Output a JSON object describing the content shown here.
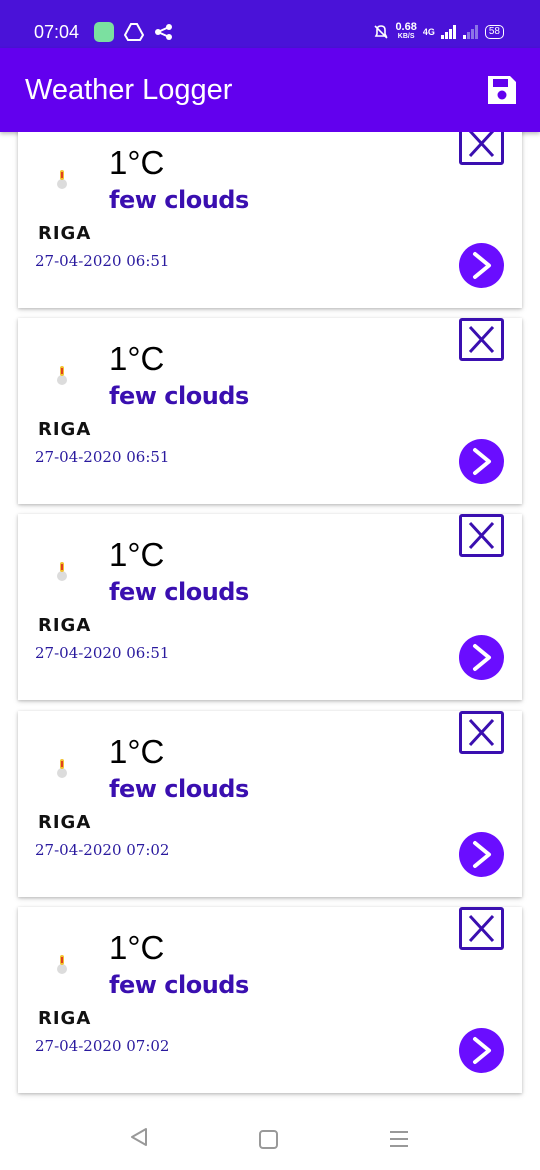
{
  "status_bar": {
    "time": "07:04",
    "net_speed": "0.68",
    "net_unit": "KB/S",
    "network": "4G",
    "battery": "58"
  },
  "app_bar": {
    "title": "Weather Logger",
    "save_icon": "save-icon"
  },
  "colors": {
    "status_bar": "#4a12d8",
    "app_bar": "#6200ee",
    "accent": "#6a0dff",
    "description_text": "#3a0fb0"
  },
  "entries": [
    {
      "temperature": "1°C",
      "description": "few clouds",
      "city": "RIGA",
      "datetime": "27-04-2020  06:51"
    },
    {
      "temperature": "1°C",
      "description": "few clouds",
      "city": "RIGA",
      "datetime": "27-04-2020  06:51"
    },
    {
      "temperature": "1°C",
      "description": "few clouds",
      "city": "RIGA",
      "datetime": "27-04-2020  06:51"
    },
    {
      "temperature": "1°C",
      "description": "few clouds",
      "city": "RIGA",
      "datetime": "27-04-2020  07:02"
    },
    {
      "temperature": "1°C",
      "description": "few clouds",
      "city": "RIGA",
      "datetime": "27-04-2020  07:02"
    }
  ],
  "nav_bar": {
    "back_icon": "back-triangle-icon",
    "home_icon": "home-square-icon",
    "menu_icon": "menu-lines-icon"
  }
}
